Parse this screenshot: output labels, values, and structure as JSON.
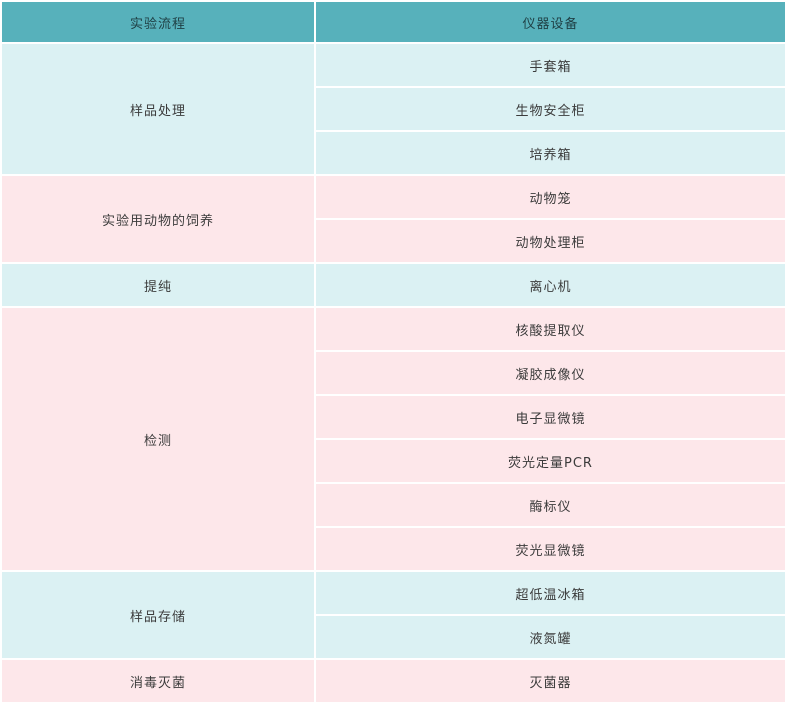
{
  "table": {
    "headers": [
      "实验流程",
      "仪器设备"
    ],
    "groups": [
      {
        "step": "样品处理",
        "equipment": [
          "手套箱",
          "生物安全柜",
          "培养箱"
        ]
      },
      {
        "step": "实验用动物的饲养",
        "equipment": [
          "动物笼",
          "动物处理柜"
        ]
      },
      {
        "step": "提纯",
        "equipment": [
          "离心机"
        ]
      },
      {
        "step": "检测",
        "equipment": [
          "核酸提取仪",
          "凝胶成像仪",
          "电子显微镜",
          "荧光定量PCR",
          "酶标仪",
          "荧光显微镜"
        ]
      },
      {
        "step": "样品存储",
        "equipment": [
          "超低温冰箱",
          "液氮罐"
        ]
      },
      {
        "step": "消毒灭菌",
        "equipment": [
          "灭菌器"
        ]
      }
    ]
  },
  "colors": {
    "header_bg": "#57b1bb",
    "row_teal": "#dbf1f3",
    "row_pink": "#fde7ea"
  }
}
